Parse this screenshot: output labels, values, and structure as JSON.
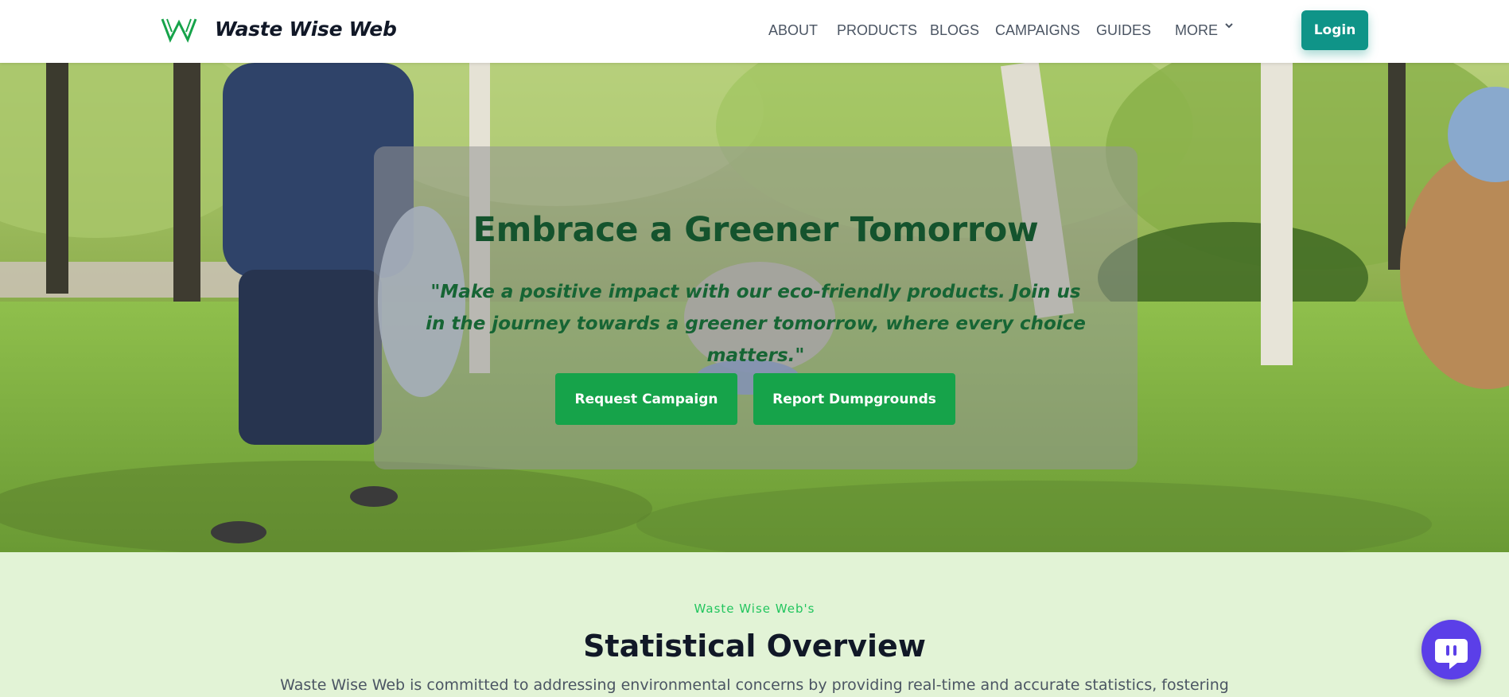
{
  "brand": {
    "name": "Waste Wise Web",
    "logo_icon": "w-logo-icon",
    "logo_color": "#16a34a"
  },
  "nav": {
    "items": [
      {
        "label": "ABOUT"
      },
      {
        "label": "PRODUCTS"
      },
      {
        "label": "BLOGS"
      },
      {
        "label": "CAMPAIGNS"
      },
      {
        "label": "GUIDES"
      },
      {
        "label": "MORE"
      }
    ],
    "more_icon": "chevron-down-icon",
    "login_label": "Login",
    "login_color": "#0f9488"
  },
  "hero": {
    "title": "Embrace a Greener Tomorrow",
    "subtitle": "\"Make a positive impact with our eco-friendly products. Join us in the journey towards a greener tomorrow, where every choice matters.\"",
    "buttons": [
      {
        "label": "Request Campaign"
      },
      {
        "label": "Report Dumpgrounds"
      }
    ],
    "button_color": "#16a34a",
    "title_color": "#14532d"
  },
  "stats": {
    "eyebrow": "Waste Wise Web's",
    "title": "Statistical Overview",
    "description": "Waste Wise Web is committed to addressing environmental concerns by providing real-time and accurate statistics, fostering",
    "background": "#e2f3d6"
  },
  "chat": {
    "icon": "chat-bubble-icon",
    "color": "#5b3fe8"
  }
}
